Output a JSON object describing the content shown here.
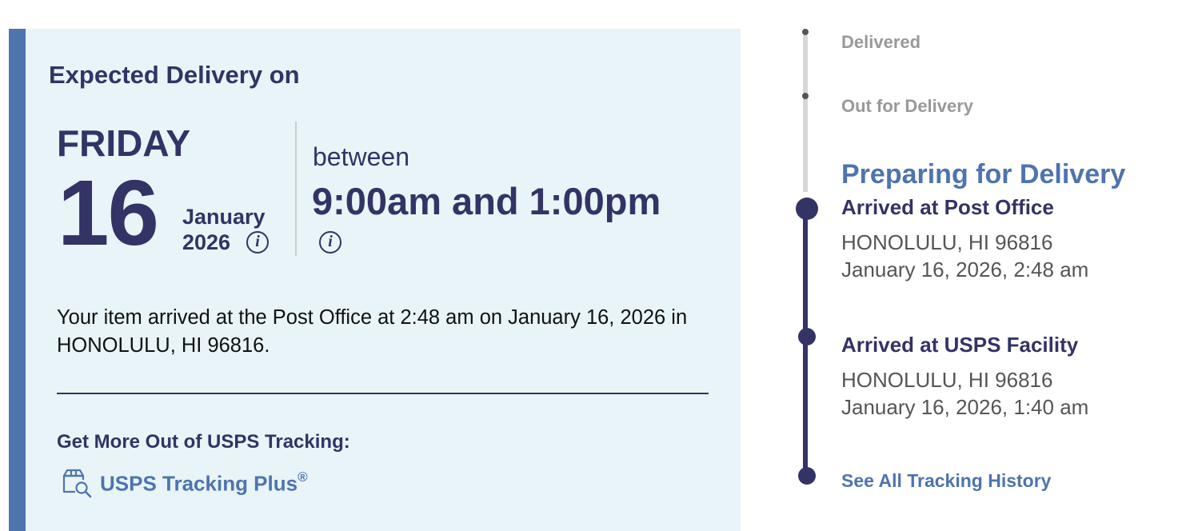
{
  "expected": {
    "title": "Expected Delivery on",
    "day_name": "FRIDAY",
    "day": "16",
    "month": "January",
    "year": "2026",
    "between_label": "between",
    "window": "9:00am and 1:00pm",
    "info_glyph": "i"
  },
  "summary": "Your item arrived at the Post Office at 2:48 am on January 16, 2026 in HONOLULU, HI 96816.",
  "more": {
    "heading": "Get More Out of USPS Tracking:",
    "link_label": "USPS Tracking Plus",
    "link_sup": "®",
    "icon": "package-search-icon"
  },
  "timeline": {
    "upcoming": [
      "Delivered",
      "Out for Delivery"
    ],
    "current_status": "Preparing for Delivery",
    "events": [
      {
        "title": "Arrived at Post Office",
        "location": "HONOLULU, HI 96816",
        "datetime": "January 16, 2026, 2:48 am"
      },
      {
        "title": "Arrived at USPS Facility",
        "location": "HONOLULU, HI 96816",
        "datetime": "January 16, 2026, 1:40 am"
      }
    ],
    "history_link": "See All Tracking History"
  },
  "colors": {
    "brand_navy": "#333366",
    "brand_blue": "#4e74ae",
    "card_bg": "#e8f4f7",
    "muted": "#999999"
  }
}
